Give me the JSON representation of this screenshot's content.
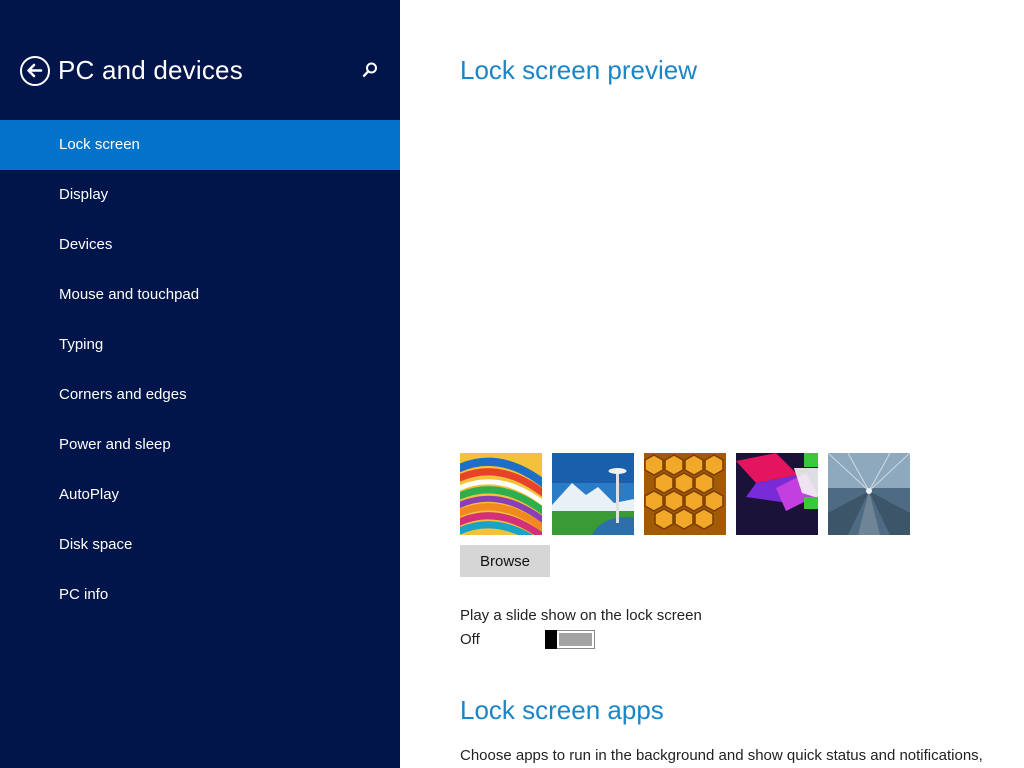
{
  "header": {
    "title": "PC and devices",
    "back_icon": "back-arrow-icon",
    "search_icon": "search-icon"
  },
  "sidebar": {
    "items": [
      {
        "label": "Lock screen",
        "selected": true
      },
      {
        "label": "Display",
        "selected": false
      },
      {
        "label": "Devices",
        "selected": false
      },
      {
        "label": "Mouse and touchpad",
        "selected": false
      },
      {
        "label": "Typing",
        "selected": false
      },
      {
        "label": "Corners and edges",
        "selected": false
      },
      {
        "label": "Power and sleep",
        "selected": false
      },
      {
        "label": "AutoPlay",
        "selected": false
      },
      {
        "label": "Disk space",
        "selected": false
      },
      {
        "label": "PC info",
        "selected": false
      }
    ]
  },
  "main": {
    "preview_title": "Lock screen preview",
    "thumbnails": [
      {
        "name": "colorful-stripes-thumbnail"
      },
      {
        "name": "space-needle-thumbnail"
      },
      {
        "name": "honeycomb-thumbnail"
      },
      {
        "name": "geometric-shapes-thumbnail"
      },
      {
        "name": "train-station-thumbnail"
      }
    ],
    "browse_label": "Browse",
    "slideshow": {
      "label": "Play a slide show on the lock screen",
      "state_label": "Off",
      "on": false
    },
    "apps_title": "Lock screen apps",
    "apps_description": "Choose apps to run in the background and show quick status and notifications,"
  },
  "colors": {
    "sidebar_bg": "#02154a",
    "selected_item": "#0372c9",
    "accent": "#1a85c7",
    "button_bg": "#d6d6d6"
  }
}
